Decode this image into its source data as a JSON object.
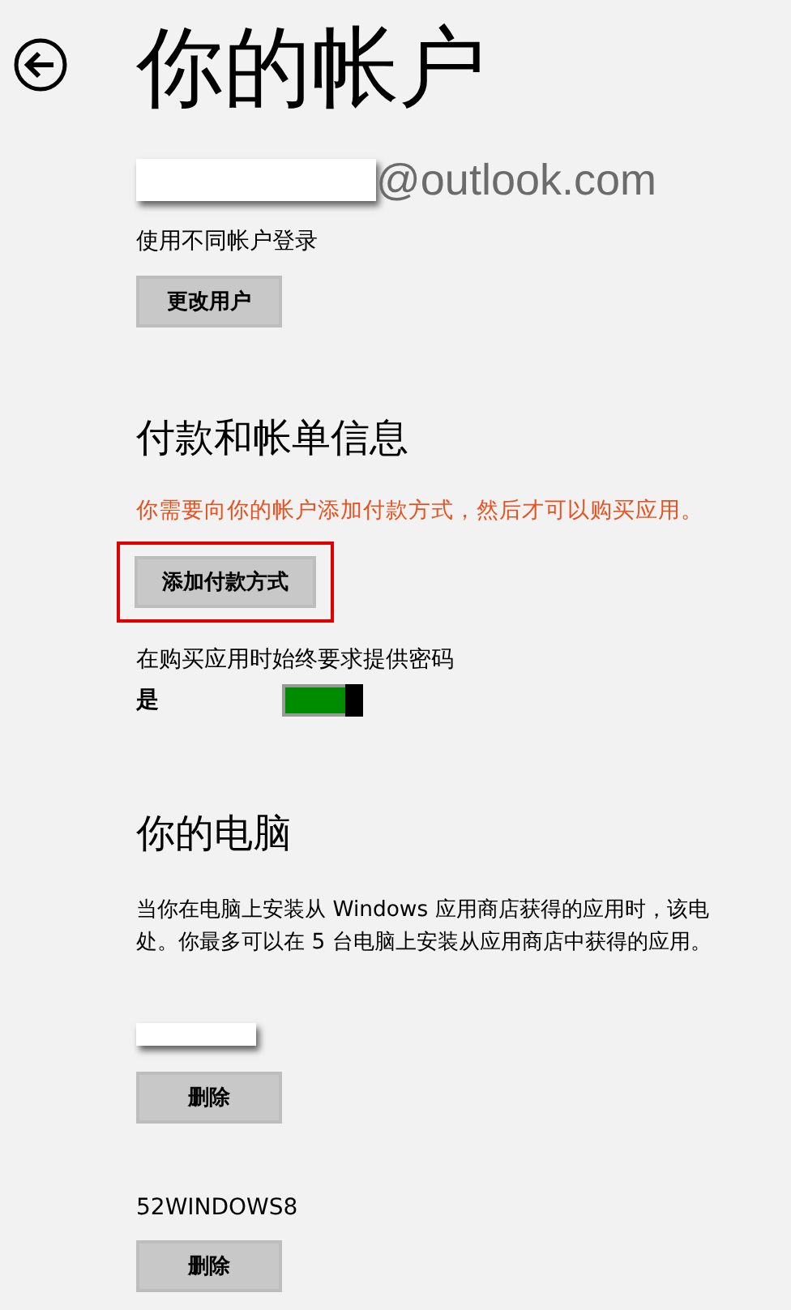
{
  "title": "你的帐户",
  "account": {
    "email_suffix": "@outlook.com",
    "switch_hint": "使用不同帐户登录",
    "change_button": "更改用户"
  },
  "payment": {
    "heading": "付款和帐单信息",
    "warning": "你需要向你的帐户添加付款方式，然后才可以购买应用。",
    "add_button": {
      "label": "添加付款方式",
      "highlighted": true
    },
    "password_label": "在购买应用时始终要求提供密码",
    "toggle": {
      "label": "是",
      "on": true
    }
  },
  "pcs": {
    "heading": "你的电脑",
    "description_lines": [
      "当你在电脑上安装从 Windows 应用商店获得的应用时，该电",
      "处。你最多可以在 5 台电脑上安装从应用商店中获得的应用。"
    ],
    "devices": [
      {
        "name_hidden": true,
        "remove_button": "删除"
      },
      {
        "name": "52WINDOWS8",
        "remove_button": "删除"
      }
    ]
  }
}
